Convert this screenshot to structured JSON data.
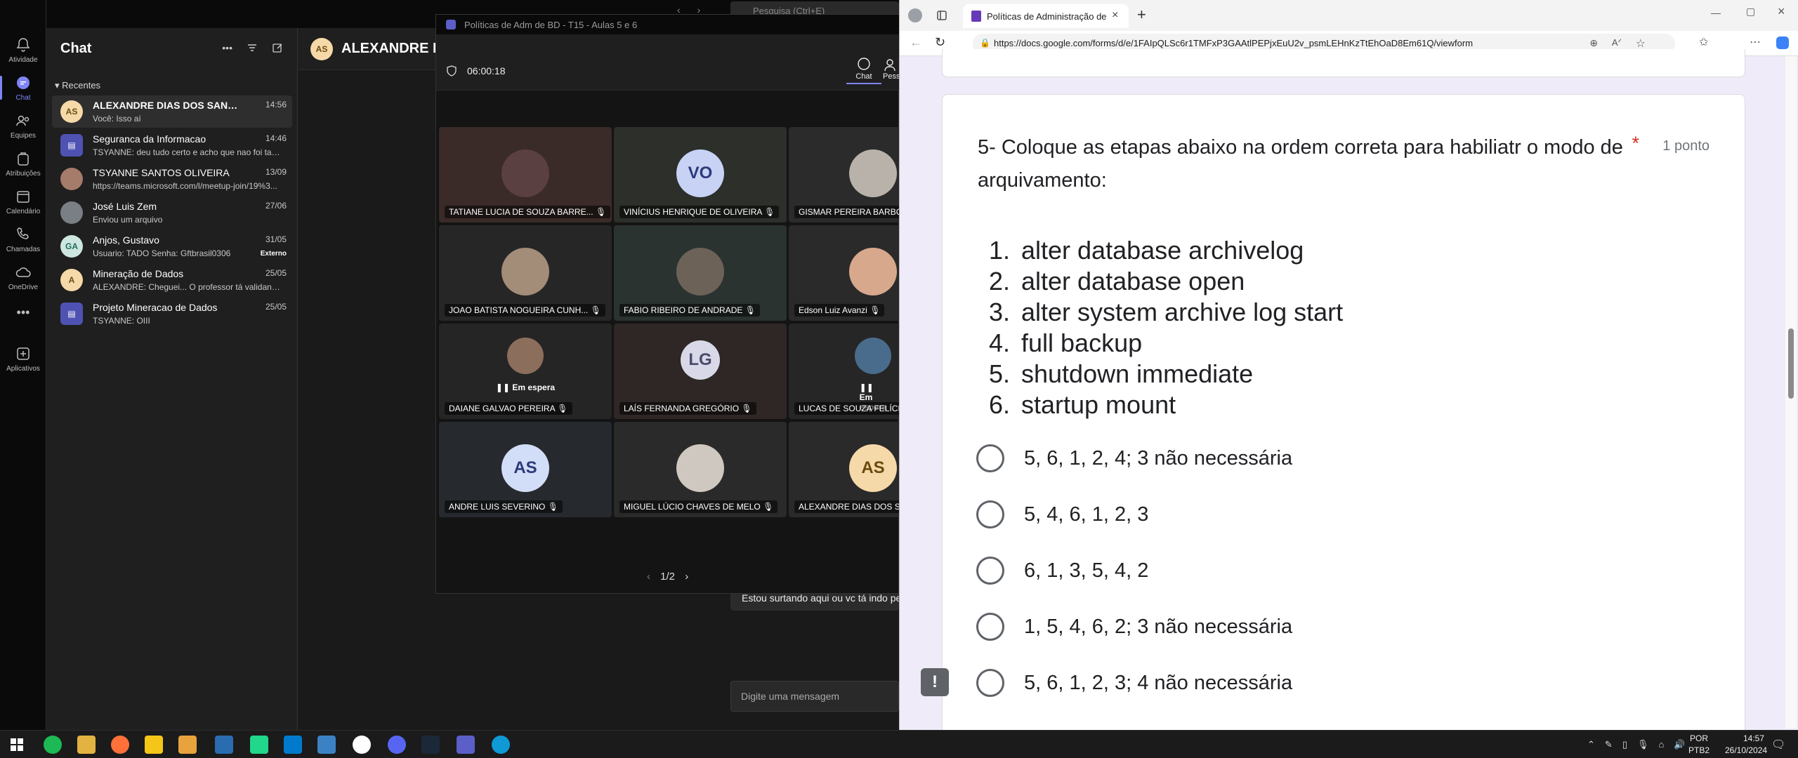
{
  "teams": {
    "search_placeholder": "Pesquisa (Ctrl+E)",
    "rail": [
      {
        "label": "Atividade"
      },
      {
        "label": "Chat"
      },
      {
        "label": "Equipes"
      },
      {
        "label": "Atribuições"
      },
      {
        "label": "Calendário"
      },
      {
        "label": "Chamadas"
      },
      {
        "label": "OneDrive"
      },
      {
        "label": "Aplicativos"
      }
    ],
    "chat_title": "Chat",
    "recentes": "Recentes",
    "chats": [
      {
        "initials": "AS",
        "name": "ALEXANDRE DIAS DOS SANTOS",
        "preview": "Você: Isso aí",
        "time": "14:56"
      },
      {
        "initials": "",
        "name": "Seguranca da Informacao",
        "preview": "TSYANNE: deu tudo certo e acho que nao foi tao ...",
        "time": "14:46"
      },
      {
        "initials": "",
        "name": "TSYANNE SANTOS OLIVEIRA",
        "preview": "https://teams.microsoft.com/l/meetup-join/19%3...",
        "time": "13/09"
      },
      {
        "initials": "",
        "name": "José Luis Zem",
        "preview": "Enviou um arquivo",
        "time": "27/06"
      },
      {
        "initials": "GA",
        "name": "Anjos, Gustavo",
        "preview": "Usuario: TADO Senha: Gftbrasil0306",
        "time": "31/05",
        "tag": "Externo"
      },
      {
        "initials": "A",
        "name": "Mineração de Dados",
        "preview": "ALEXANDRE: Cheguei... O professor tá validando ...",
        "time": "25/05"
      },
      {
        "initials": "",
        "name": "Projeto Mineracao de Dados",
        "preview": "TSYANNE: OIII",
        "time": "25/05"
      }
    ],
    "conv_avatar": "AS",
    "conv_name": "ALEXANDRE DIAS",
    "message_partial": "Estou surtando aqui ou vc tá indo pe",
    "message_placeholder": "Digite uma mensagem"
  },
  "meeting": {
    "title": "Políticas de Adm de BD - T15 - Aulas 5 e 6",
    "timer": "06:00:18",
    "toolbar_chat": "Chat",
    "toolbar_people": "Pessoas",
    "pager": "1/2",
    "on_hold": "Em espera",
    "participants": [
      {
        "name": "TATIANE LUCIA DE SOUZA BARRE...",
        "initials": ""
      },
      {
        "name": "VINÍCIUS HENRIQUE DE OLIVEIRA",
        "initials": "VO"
      },
      {
        "name": "GISMAR PEREIRA BARBOSA",
        "initials": ""
      },
      {
        "name": "JOAO BATISTA NOGUEIRA CUNH...",
        "initials": ""
      },
      {
        "name": "FABIO RIBEIRO DE ANDRADE",
        "initials": ""
      },
      {
        "name": "Edson Luiz Avanzi",
        "initials": ""
      },
      {
        "name": "DAIANE GALVAO PEREIRA",
        "initials": ""
      },
      {
        "name": "LAÍS FERNANDA GREGÓRIO",
        "initials": "LG"
      },
      {
        "name": "LUCAS DE SOUZA FELÍCIO",
        "initials": ""
      },
      {
        "name": "ANDRE LUIS SEVERINO",
        "initials": "AS"
      },
      {
        "name": "MIGUEL LÚCIO CHAVES DE MELO",
        "initials": ""
      },
      {
        "name": "ALEXANDRE DIAS DOS SAN...",
        "initials": "AS"
      }
    ]
  },
  "browser": {
    "tab_title": "Políticas de Administração de Ba",
    "url": "https://docs.google.com/forms/d/e/1FAIpQLSc6r1TMFxP3GAAtlPEPjxEuU2v_psmLEHnKzTtEhOaD8Em61Q/viewform",
    "question_title": "5- Coloque as etapas abaixo na ordem correta para habiliatr o modo de arquivamento:",
    "required_mark": "*",
    "points": "1 ponto",
    "steps": [
      {
        "num": "1.",
        "text": "alter database archivelog"
      },
      {
        "num": "2.",
        "text": "alter database open"
      },
      {
        "num": "3.",
        "text": "alter system archive log start"
      },
      {
        "num": "4.",
        "text": "full backup"
      },
      {
        "num": "5.",
        "text": "shutdown immediate"
      },
      {
        "num": "6.",
        "text": "startup mount"
      }
    ],
    "options": [
      "5, 6, 1, 2, 4; 3 não necessária",
      "5, 4, 6, 1, 2, 3",
      "6, 1, 3, 5, 4, 2",
      "1, 5, 4, 6, 2; 3 não necessária",
      "5, 6, 1, 2, 3; 4 não necessária"
    ]
  },
  "taskbar": {
    "lang": "POR",
    "layout": "PTB2",
    "time": "14:57",
    "date": "26/10/2024"
  },
  "colors": {
    "teams_accent": "#7f85f5",
    "forms_bg": "#f0ebf8",
    "required_red": "#d93025"
  }
}
